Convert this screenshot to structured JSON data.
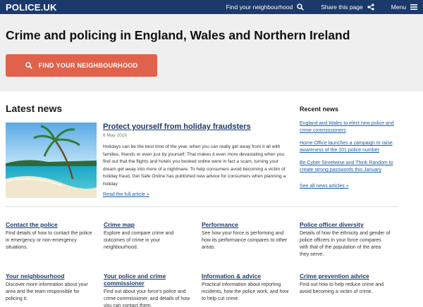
{
  "header": {
    "logo": "POLICE.UK",
    "find_label": "Find your neighbourhood",
    "share_label": "Share this page",
    "menu_label": "Menu"
  },
  "hero": {
    "title": "Crime and policing in England, Wales and Northern Ireland",
    "cta_label": "FIND YOUR NEIGHBOURHOOD"
  },
  "news": {
    "heading": "Latest news",
    "article": {
      "title": "Protect yourself from holiday fraudsters",
      "date": "6 May 2016",
      "body": "Holidays can be the best time of the year, when you can really get away from it all with families, friends or even just by yourself. That makes it even more devastating when you find out that the flights and hotels you booked online were in fact a scam, turning your dream get away into more of a nightmare. To help consumers avoid becoming a victim of holiday fraud, Get Safe Online has published new advice for consumers when planning a holiday",
      "more_label": "Read the full article »"
    }
  },
  "recent": {
    "heading": "Recent news",
    "items": [
      "England and Wales to elect new police and crime commissioners",
      "Home Office launches a campaign to raise awareness of the 101 police number",
      "Be Cyber Streetwise and Think Random to create strong passwords this January"
    ],
    "all_label": "See all news articles »"
  },
  "links": {
    "row1": [
      {
        "title": "Contact the police",
        "desc": "Find details of how to contact the police in emergency or non-emergency situations."
      },
      {
        "title": "Crime map",
        "desc": "Explore and compare crime and outcomes of crime in your neighbourhood."
      },
      {
        "title": "Performance",
        "desc": "See how your force is performing and how its performance compares to other areas."
      },
      {
        "title": "Police officer diversity",
        "desc": "Details of how the ethnicity and gender of police officers in your force compares with that of the population of the area they serve."
      }
    ],
    "row2": [
      {
        "title": "Your neighbourhood",
        "desc": "Discover more information about your area and the team responsible for policing it."
      },
      {
        "title": "Your police and crime commissioner",
        "desc": "Find out about your force's police and crime commissioner, and details of how you can contact them."
      },
      {
        "title": "Information & advice",
        "desc": "Practical information about reporting incidents, how the police work, and how to help cut crime."
      },
      {
        "title": "Crime prevention advice",
        "desc": "Find out how to help reduce crime and avoid becoming a victim of crime."
      }
    ]
  },
  "colors": {
    "header_bg": "#1b3a6b",
    "cta_bg": "#e0624c",
    "link": "#1b5fa8"
  }
}
